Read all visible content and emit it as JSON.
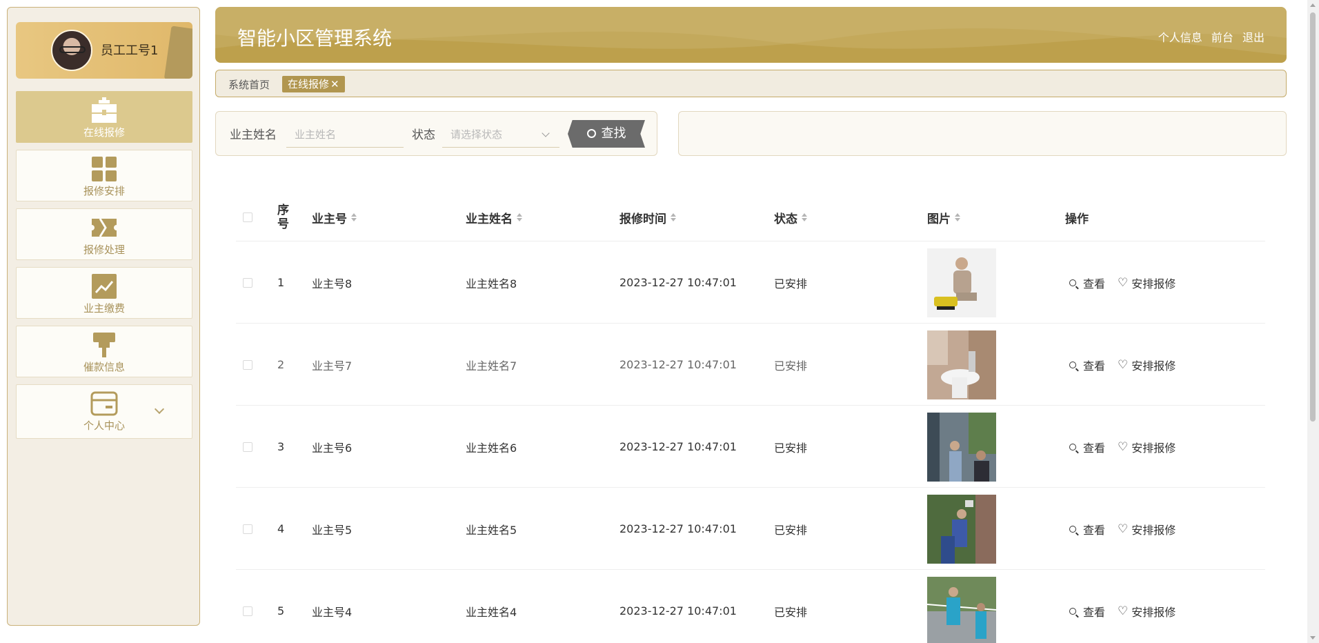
{
  "header": {
    "title": "智能小区管理系统",
    "links": [
      "个人信息",
      "前台",
      "退出"
    ]
  },
  "sidebar": {
    "user": "员工工号1",
    "items": [
      {
        "label": "在线报修",
        "icon": "toolbox-icon",
        "active": true
      },
      {
        "label": "报修安排",
        "icon": "grid-icon",
        "active": false
      },
      {
        "label": "报修处理",
        "icon": "ticket-icon",
        "active": false
      },
      {
        "label": "业主缴费",
        "icon": "chart-icon",
        "active": false
      },
      {
        "label": "催款信息",
        "icon": "brush-icon",
        "active": false
      },
      {
        "label": "个人中心",
        "icon": "card-icon",
        "active": false
      }
    ]
  },
  "breadcrumb": {
    "home": "系统首页",
    "current": "在线报修",
    "close": "✕"
  },
  "search": {
    "name_label": "业主姓名",
    "name_placeholder": "业主姓名",
    "status_label": "状态",
    "status_placeholder": "请选择状态",
    "button": "查找"
  },
  "table": {
    "headers": [
      "序号",
      "业主号",
      "业主姓名",
      "报修时间",
      "状态",
      "图片",
      "操作"
    ],
    "actions": {
      "view": "查看",
      "arrange": "安排报修"
    },
    "rows": [
      {
        "index": "1",
        "owner_no": "业主号8",
        "owner_name": "业主姓名8",
        "time": "2023-12-27 10:47:01",
        "status": "已安排"
      },
      {
        "index": "2",
        "owner_no": "业主号7",
        "owner_name": "业主姓名7",
        "time": "2023-12-27 10:47:01",
        "status": "已安排"
      },
      {
        "index": "3",
        "owner_no": "业主号6",
        "owner_name": "业主姓名6",
        "time": "2023-12-27 10:47:01",
        "status": "已安排"
      },
      {
        "index": "4",
        "owner_no": "业主号5",
        "owner_name": "业主姓名5",
        "time": "2023-12-27 10:47:01",
        "status": "已安排"
      },
      {
        "index": "5",
        "owner_no": "业主号4",
        "owner_name": "业主姓名4",
        "time": "2023-12-27 10:47:01",
        "status": "已安排"
      }
    ]
  },
  "colors": {
    "accent": "#c3a95c",
    "active_nav": "#dcc98e",
    "sidebar_bg": "#f3eee4",
    "nav_label": "#a8925a"
  }
}
